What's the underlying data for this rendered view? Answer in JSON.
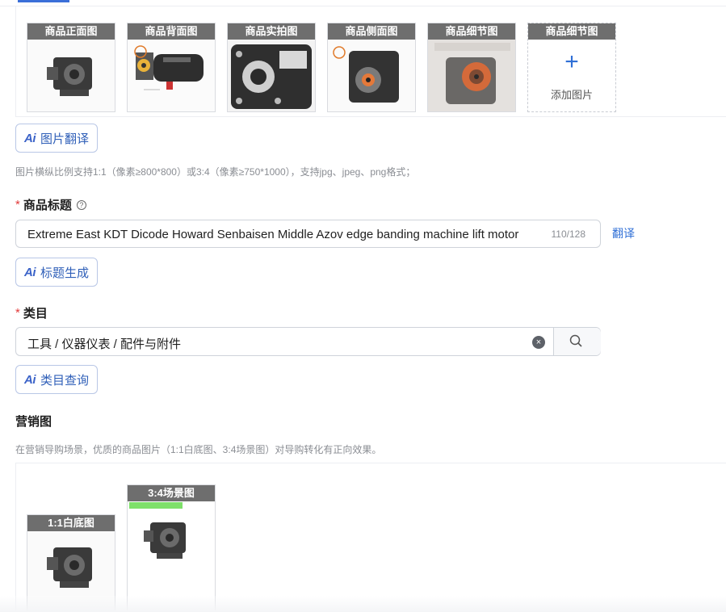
{
  "product_images": {
    "slots": [
      {
        "label": "商品正面图"
      },
      {
        "label": "商品背面图"
      },
      {
        "label": "商品实拍图"
      },
      {
        "label": "商品侧面图"
      },
      {
        "label": "商品细节图"
      },
      {
        "label": "商品细节图"
      }
    ],
    "add_label": "添加图片",
    "add_icon": "+"
  },
  "image_translate_button": "图片翻译",
  "ai_mark": "Ai",
  "image_hint": "图片横纵比例支持1:1（像素≥800*800）或3:4（像素≥750*1000），支持jpg、jpeg、png格式；",
  "title_field": {
    "required_mark": "*",
    "label": "商品标题",
    "help_icon": "?",
    "value": "Extreme East KDT Dicode Howard Senbaisen Middle Azov edge banding machine lift motor",
    "counter": "110/128",
    "translate_link": "翻译"
  },
  "title_generate_button": "标题生成",
  "category_field": {
    "required_mark": "*",
    "label": "类目",
    "value": "工具 / 仪器仪表 / 配件与附件",
    "clear_icon": "×"
  },
  "category_query_button": "类目查询",
  "marketing": {
    "label": "营销图",
    "hint": "在营销导购场景，优质的商品图片（1:1白底图、3:4场景图）对导购转化有正向效果。",
    "slots": [
      {
        "label": "1:1白底图"
      },
      {
        "label": "3:4场景图"
      }
    ]
  },
  "colors": {
    "accent": "#2f6fd6",
    "required": "#e23b3b",
    "caption_bg": "#5a5a5a"
  }
}
